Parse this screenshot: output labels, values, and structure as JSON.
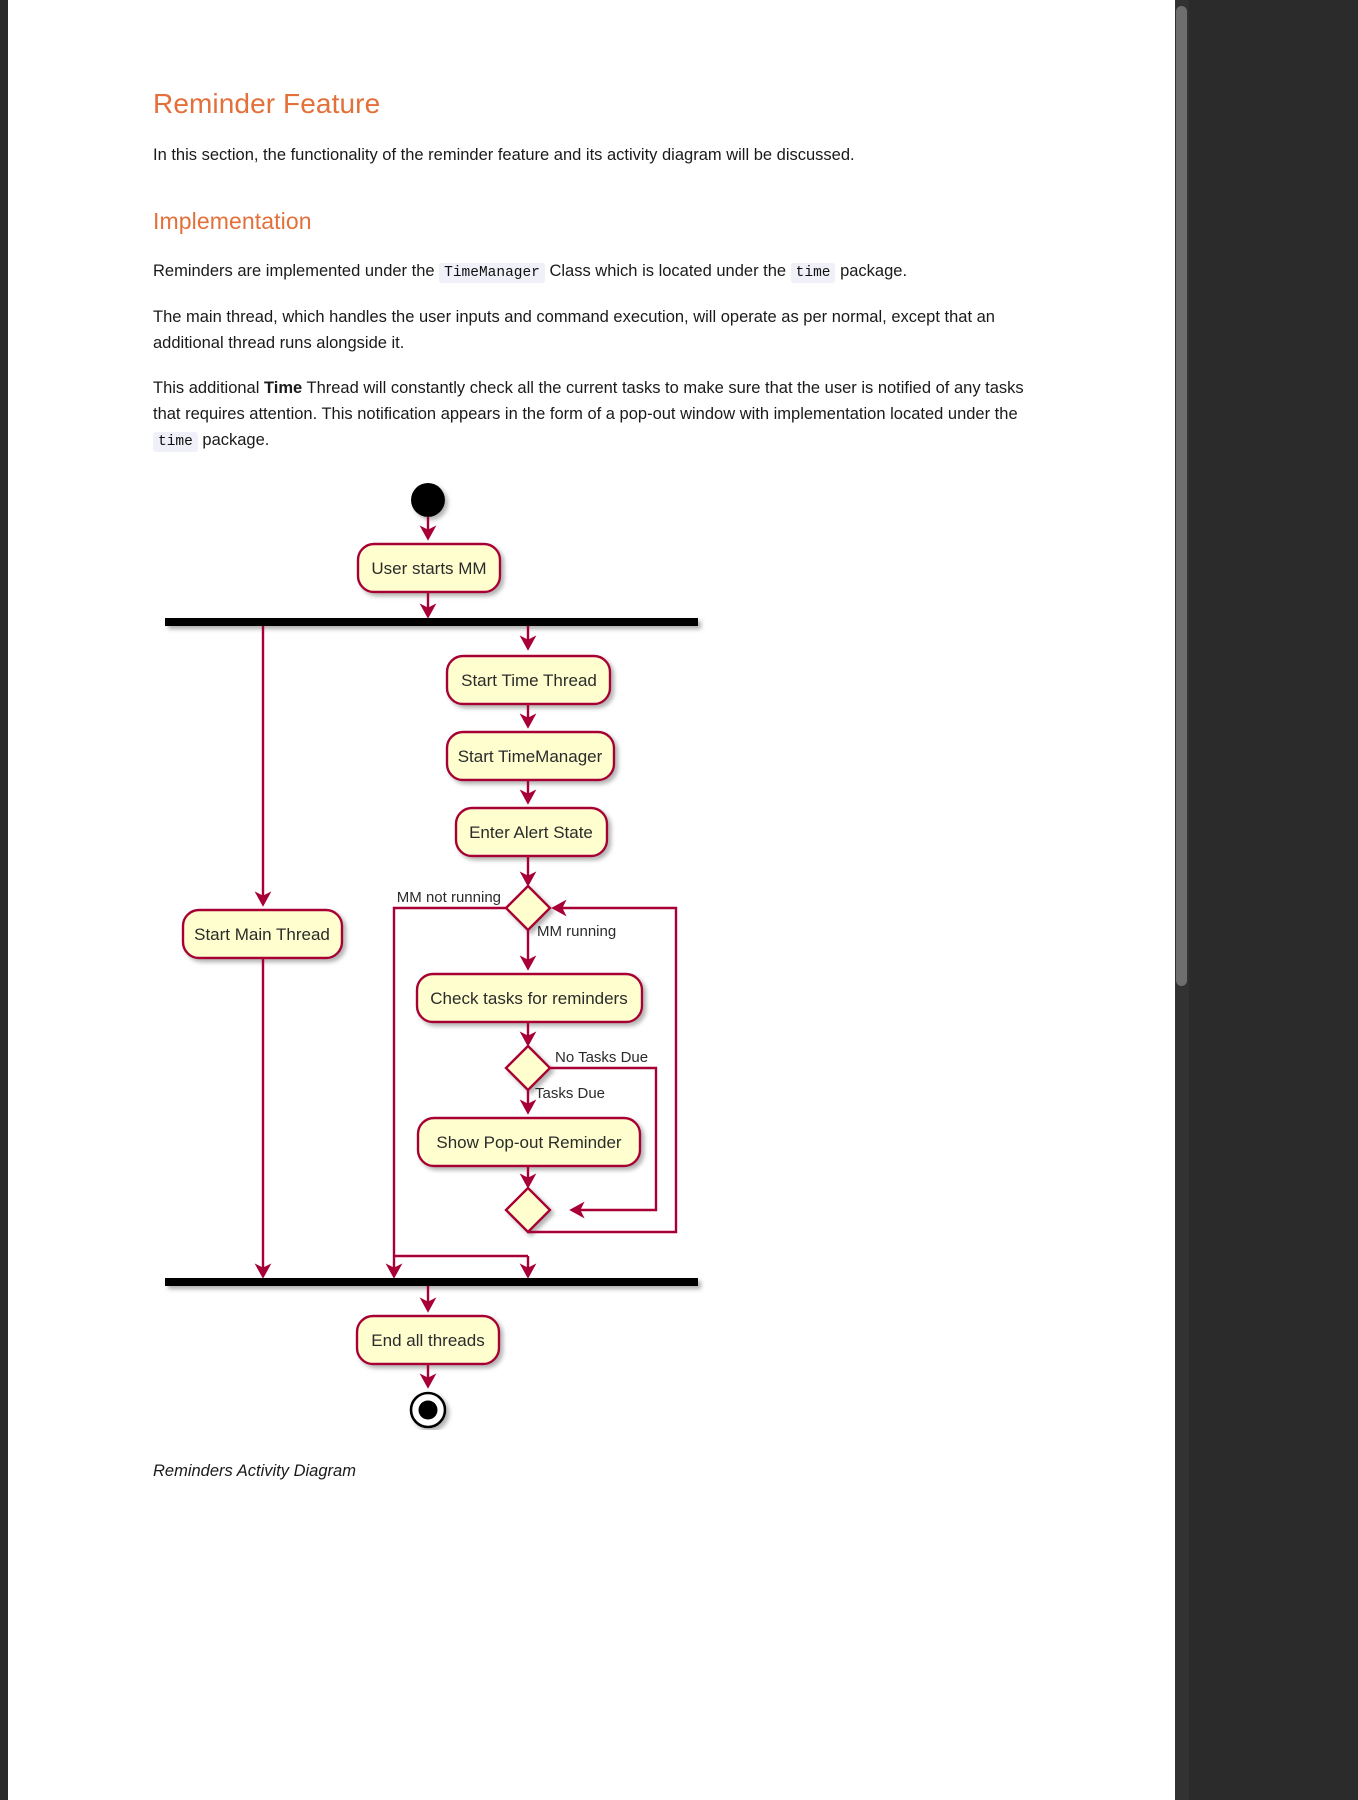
{
  "page": {
    "section_title": "Reminder Feature",
    "intro": "In this section, the functionality of the reminder feature and its activity diagram will be discussed.",
    "sub_title": "Implementation",
    "para_impl_a": "Reminders are implemented under the ",
    "code_timemanager": "TimeManager",
    "para_impl_b": " Class which is located under the ",
    "code_time_1": "time",
    "para_impl_c": " package.",
    "para_main_thread": "The main thread, which handles the user inputs and command execution, will operate as per normal, except that an additional thread runs alongside it.",
    "para_time_a": "This additional ",
    "para_time_bold": "Time",
    "para_time_b": " Thread will constantly check all the current tasks to make sure that the user is notified of any tasks that requires attention. This notification appears in the form of a pop-out window with implementation located under the ",
    "code_time_2": "time",
    "para_time_c": " package.",
    "caption": "Reminders Activity Diagram"
  },
  "diagram": {
    "type": "uml-activity-diagram",
    "colors": {
      "node_fill": "#FEFECE",
      "node_border": "#A80036",
      "arrow": "#A80036",
      "bar": "#000000",
      "label_text": "#000000"
    },
    "nodes": {
      "start": "start-node",
      "user_starts_mm": "User starts MM",
      "fork_bar_top": "fork-bar",
      "start_main_thread": "Start Main Thread",
      "start_time_thread": "Start Time Thread",
      "start_timemanager": "Start TimeManager",
      "enter_alert_state": "Enter Alert State",
      "decision_mm": "decision-mm-running",
      "check_tasks": "Check tasks for reminders",
      "decision_tasks": "decision-tasks-due",
      "show_popout": "Show Pop-out Reminder",
      "merge_node": "merge-node",
      "join_bar_bottom": "join-bar",
      "end_all_threads": "End all threads",
      "end": "end-node"
    },
    "edge_labels": {
      "mm_not_running": "MM not running",
      "mm_running": "MM running",
      "no_tasks_due": "No Tasks Due",
      "tasks_due": "Tasks Due"
    }
  }
}
